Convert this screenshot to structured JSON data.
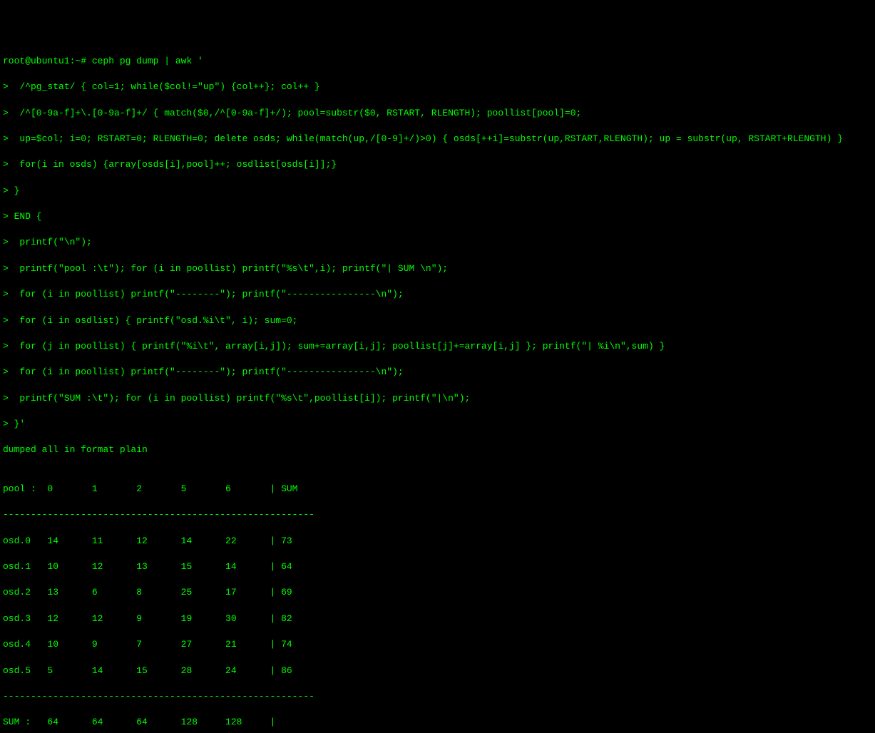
{
  "prompt": "root@ubuntu1:~# ",
  "command": "ceph pg dump | awk '",
  "script_lines": [
    ">  /^pg_stat/ { col=1; while($col!=\"up\") {col++}; col++ }",
    ">  /^[0-9a-f]+\\.[0-9a-f]+/ { match($0,/^[0-9a-f]+/); pool=substr($0, RSTART, RLENGTH); poollist[pool]=0;",
    ">  up=$col; i=0; RSTART=0; RLENGTH=0; delete osds; while(match(up,/[0-9]+/)>0) { osds[++i]=substr(up,RSTART,RLENGTH); up = substr(up, RSTART+RLENGTH) }",
    ">  for(i in osds) {array[osds[i],pool]++; osdlist[osds[i]];}",
    "> }",
    "> END {",
    ">  printf(\"\\n\");",
    ">  printf(\"pool :\\t\"); for (i in poollist) printf(\"%s\\t\",i); printf(\"| SUM \\n\");",
    ">  for (i in poollist) printf(\"--------\"); printf(\"----------------\\n\");",
    ">  for (i in osdlist) { printf(\"osd.%i\\t\", i); sum=0;",
    ">  for (j in poollist) { printf(\"%i\\t\", array[i,j]); sum+=array[i,j]; poollist[j]+=array[i,j] }; printf(\"| %i\\n\",sum) }",
    ">  for (i in poollist) printf(\"--------\"); printf(\"----------------\\n\");",
    ">  printf(\"SUM :\\t\"); for (i in poollist) printf(\"%s\\t\",poollist[i]); printf(\"|\\n\");",
    "> }'"
  ],
  "output_header": "dumped all in format plain",
  "blank_line": "",
  "table_header": "pool :  0       1       2       5       6       | SUM ",
  "divider": "--------------------------------------------------------",
  "chart_data": {
    "type": "table",
    "title": "Ceph OSD Pool Distribution",
    "columns": [
      "pool",
      "0",
      "1",
      "2",
      "5",
      "6",
      "SUM"
    ],
    "rows": [
      {
        "osd": "osd.0",
        "values": [
          14,
          11,
          12,
          14,
          22
        ],
        "sum": 73
      },
      {
        "osd": "osd.1",
        "values": [
          10,
          12,
          13,
          15,
          14
        ],
        "sum": 64
      },
      {
        "osd": "osd.2",
        "values": [
          13,
          6,
          8,
          25,
          17
        ],
        "sum": 69
      },
      {
        "osd": "osd.3",
        "values": [
          12,
          12,
          9,
          19,
          30
        ],
        "sum": 82
      },
      {
        "osd": "osd.4",
        "values": [
          10,
          9,
          7,
          27,
          21
        ],
        "sum": 74
      },
      {
        "osd": "osd.5",
        "values": [
          5,
          14,
          15,
          28,
          24
        ],
        "sum": 86
      }
    ],
    "sum_row": {
      "label": "SUM :",
      "values": [
        64,
        64,
        64,
        128,
        128
      ]
    }
  },
  "table_rows": [
    "osd.0   14      11      12      14      22      | 73",
    "osd.1   10      12      13      15      14      | 64",
    "osd.2   13      6       8       25      17      | 69",
    "osd.3   12      12      9       19      30      | 82",
    "osd.4   10      9       7       27      21      | 74",
    "osd.5   5       14      15      28      24      | 86"
  ],
  "sum_line": "SUM :   64      64      64      128     128     |"
}
